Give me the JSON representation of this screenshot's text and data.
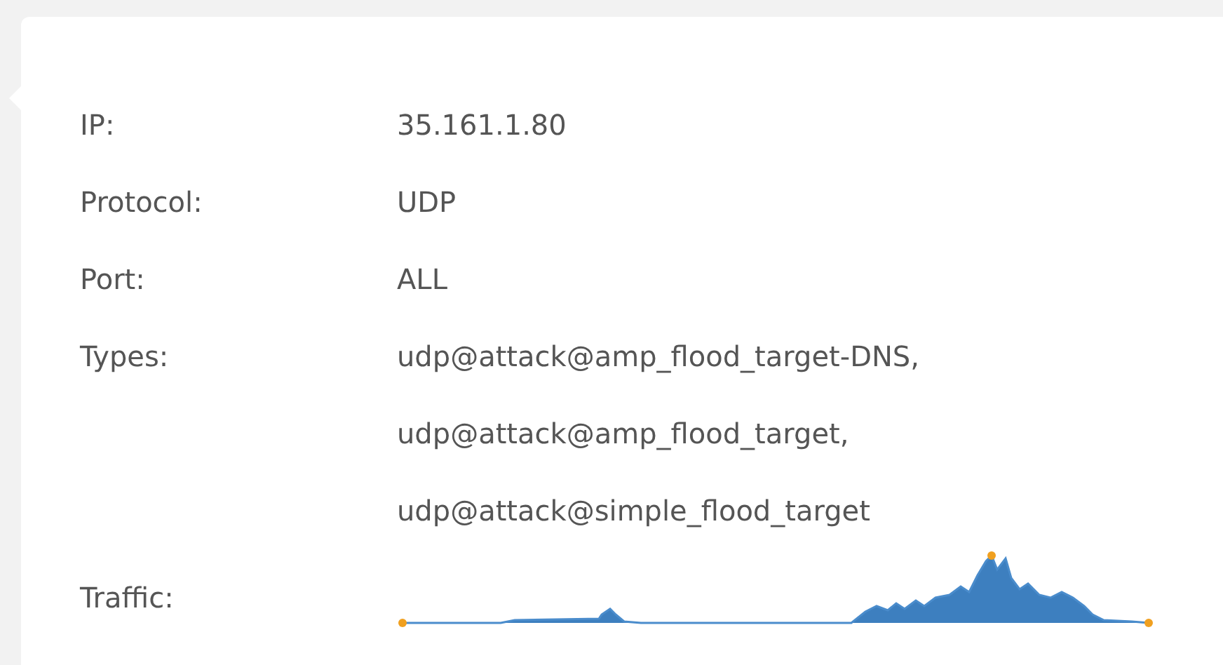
{
  "fields": [
    {
      "label": "IP:",
      "values": [
        "35.161.1.80"
      ]
    },
    {
      "label": "Protocol:",
      "values": [
        "UDP"
      ]
    },
    {
      "label": "Port:",
      "values": [
        "ALL"
      ]
    },
    {
      "label": "Types:",
      "values": [
        "udp@attack@amp_flood_target-DNS,",
        "udp@attack@amp_flood_target,",
        "udp@attack@simple_flood_target"
      ]
    }
  ],
  "traffic": {
    "label": "Traffic:"
  }
}
